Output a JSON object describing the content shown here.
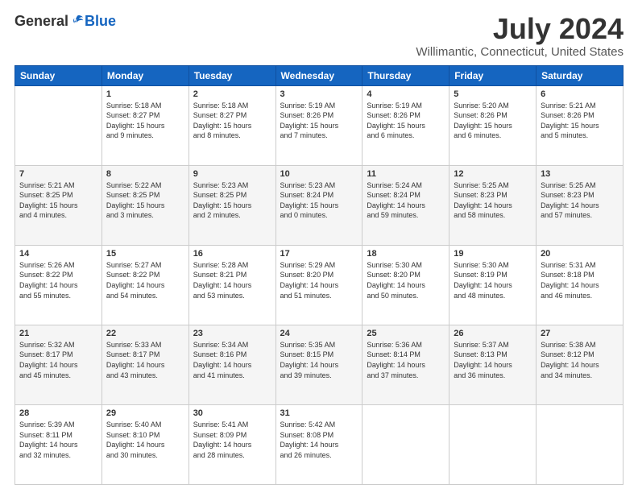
{
  "logo": {
    "general": "General",
    "blue": "Blue"
  },
  "header": {
    "month": "July 2024",
    "location": "Willimantic, Connecticut, United States"
  },
  "weekdays": [
    "Sunday",
    "Monday",
    "Tuesday",
    "Wednesday",
    "Thursday",
    "Friday",
    "Saturday"
  ],
  "weeks": [
    [
      {
        "day": "",
        "info": ""
      },
      {
        "day": "1",
        "info": "Sunrise: 5:18 AM\nSunset: 8:27 PM\nDaylight: 15 hours\nand 9 minutes."
      },
      {
        "day": "2",
        "info": "Sunrise: 5:18 AM\nSunset: 8:27 PM\nDaylight: 15 hours\nand 8 minutes."
      },
      {
        "day": "3",
        "info": "Sunrise: 5:19 AM\nSunset: 8:26 PM\nDaylight: 15 hours\nand 7 minutes."
      },
      {
        "day": "4",
        "info": "Sunrise: 5:19 AM\nSunset: 8:26 PM\nDaylight: 15 hours\nand 6 minutes."
      },
      {
        "day": "5",
        "info": "Sunrise: 5:20 AM\nSunset: 8:26 PM\nDaylight: 15 hours\nand 6 minutes."
      },
      {
        "day": "6",
        "info": "Sunrise: 5:21 AM\nSunset: 8:26 PM\nDaylight: 15 hours\nand 5 minutes."
      }
    ],
    [
      {
        "day": "7",
        "info": "Sunrise: 5:21 AM\nSunset: 8:25 PM\nDaylight: 15 hours\nand 4 minutes."
      },
      {
        "day": "8",
        "info": "Sunrise: 5:22 AM\nSunset: 8:25 PM\nDaylight: 15 hours\nand 3 minutes."
      },
      {
        "day": "9",
        "info": "Sunrise: 5:23 AM\nSunset: 8:25 PM\nDaylight: 15 hours\nand 2 minutes."
      },
      {
        "day": "10",
        "info": "Sunrise: 5:23 AM\nSunset: 8:24 PM\nDaylight: 15 hours\nand 0 minutes."
      },
      {
        "day": "11",
        "info": "Sunrise: 5:24 AM\nSunset: 8:24 PM\nDaylight: 14 hours\nand 59 minutes."
      },
      {
        "day": "12",
        "info": "Sunrise: 5:25 AM\nSunset: 8:23 PM\nDaylight: 14 hours\nand 58 minutes."
      },
      {
        "day": "13",
        "info": "Sunrise: 5:25 AM\nSunset: 8:23 PM\nDaylight: 14 hours\nand 57 minutes."
      }
    ],
    [
      {
        "day": "14",
        "info": "Sunrise: 5:26 AM\nSunset: 8:22 PM\nDaylight: 14 hours\nand 55 minutes."
      },
      {
        "day": "15",
        "info": "Sunrise: 5:27 AM\nSunset: 8:22 PM\nDaylight: 14 hours\nand 54 minutes."
      },
      {
        "day": "16",
        "info": "Sunrise: 5:28 AM\nSunset: 8:21 PM\nDaylight: 14 hours\nand 53 minutes."
      },
      {
        "day": "17",
        "info": "Sunrise: 5:29 AM\nSunset: 8:20 PM\nDaylight: 14 hours\nand 51 minutes."
      },
      {
        "day": "18",
        "info": "Sunrise: 5:30 AM\nSunset: 8:20 PM\nDaylight: 14 hours\nand 50 minutes."
      },
      {
        "day": "19",
        "info": "Sunrise: 5:30 AM\nSunset: 8:19 PM\nDaylight: 14 hours\nand 48 minutes."
      },
      {
        "day": "20",
        "info": "Sunrise: 5:31 AM\nSunset: 8:18 PM\nDaylight: 14 hours\nand 46 minutes."
      }
    ],
    [
      {
        "day": "21",
        "info": "Sunrise: 5:32 AM\nSunset: 8:17 PM\nDaylight: 14 hours\nand 45 minutes."
      },
      {
        "day": "22",
        "info": "Sunrise: 5:33 AM\nSunset: 8:17 PM\nDaylight: 14 hours\nand 43 minutes."
      },
      {
        "day": "23",
        "info": "Sunrise: 5:34 AM\nSunset: 8:16 PM\nDaylight: 14 hours\nand 41 minutes."
      },
      {
        "day": "24",
        "info": "Sunrise: 5:35 AM\nSunset: 8:15 PM\nDaylight: 14 hours\nand 39 minutes."
      },
      {
        "day": "25",
        "info": "Sunrise: 5:36 AM\nSunset: 8:14 PM\nDaylight: 14 hours\nand 37 minutes."
      },
      {
        "day": "26",
        "info": "Sunrise: 5:37 AM\nSunset: 8:13 PM\nDaylight: 14 hours\nand 36 minutes."
      },
      {
        "day": "27",
        "info": "Sunrise: 5:38 AM\nSunset: 8:12 PM\nDaylight: 14 hours\nand 34 minutes."
      }
    ],
    [
      {
        "day": "28",
        "info": "Sunrise: 5:39 AM\nSunset: 8:11 PM\nDaylight: 14 hours\nand 32 minutes."
      },
      {
        "day": "29",
        "info": "Sunrise: 5:40 AM\nSunset: 8:10 PM\nDaylight: 14 hours\nand 30 minutes."
      },
      {
        "day": "30",
        "info": "Sunrise: 5:41 AM\nSunset: 8:09 PM\nDaylight: 14 hours\nand 28 minutes."
      },
      {
        "day": "31",
        "info": "Sunrise: 5:42 AM\nSunset: 8:08 PM\nDaylight: 14 hours\nand 26 minutes."
      },
      {
        "day": "",
        "info": ""
      },
      {
        "day": "",
        "info": ""
      },
      {
        "day": "",
        "info": ""
      }
    ]
  ]
}
